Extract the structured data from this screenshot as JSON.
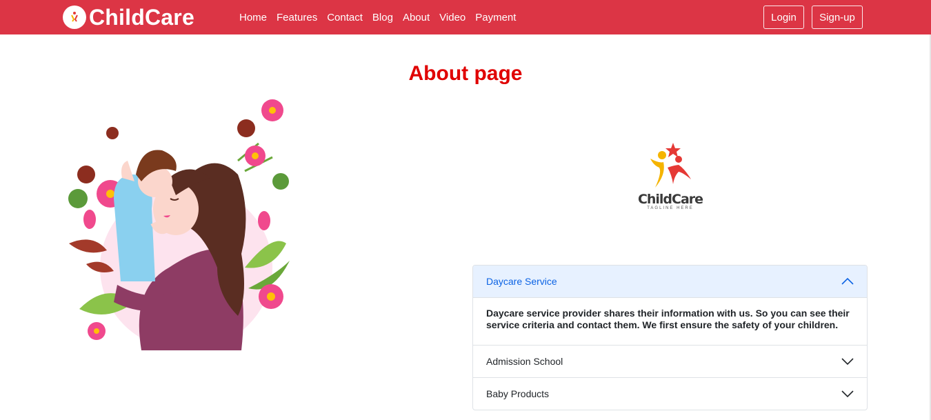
{
  "navbar": {
    "brand": "ChildCare",
    "links": [
      "Home",
      "Features",
      "Contact",
      "Blog",
      "About",
      "Video",
      "Payment"
    ],
    "login_label": "Login",
    "signup_label": "Sign-up",
    "color": "#dc3545"
  },
  "page": {
    "title": "About page",
    "title_color": "#e00000"
  },
  "logo": {
    "word": "ChildCare",
    "tagline": "TAGLINE HERE"
  },
  "accordion": {
    "items": [
      {
        "label": "Daycare Service",
        "expanded": true,
        "body": "Daycare service provider shares their information with us. So you can see their service criteria and contact them. We first ensure the safety of your children."
      },
      {
        "label": "Admission School",
        "expanded": false
      },
      {
        "label": "Baby Products",
        "expanded": false
      }
    ]
  },
  "icons": [
    "childcare-logo-icon",
    "chevron-up-icon",
    "chevron-down-icon"
  ]
}
